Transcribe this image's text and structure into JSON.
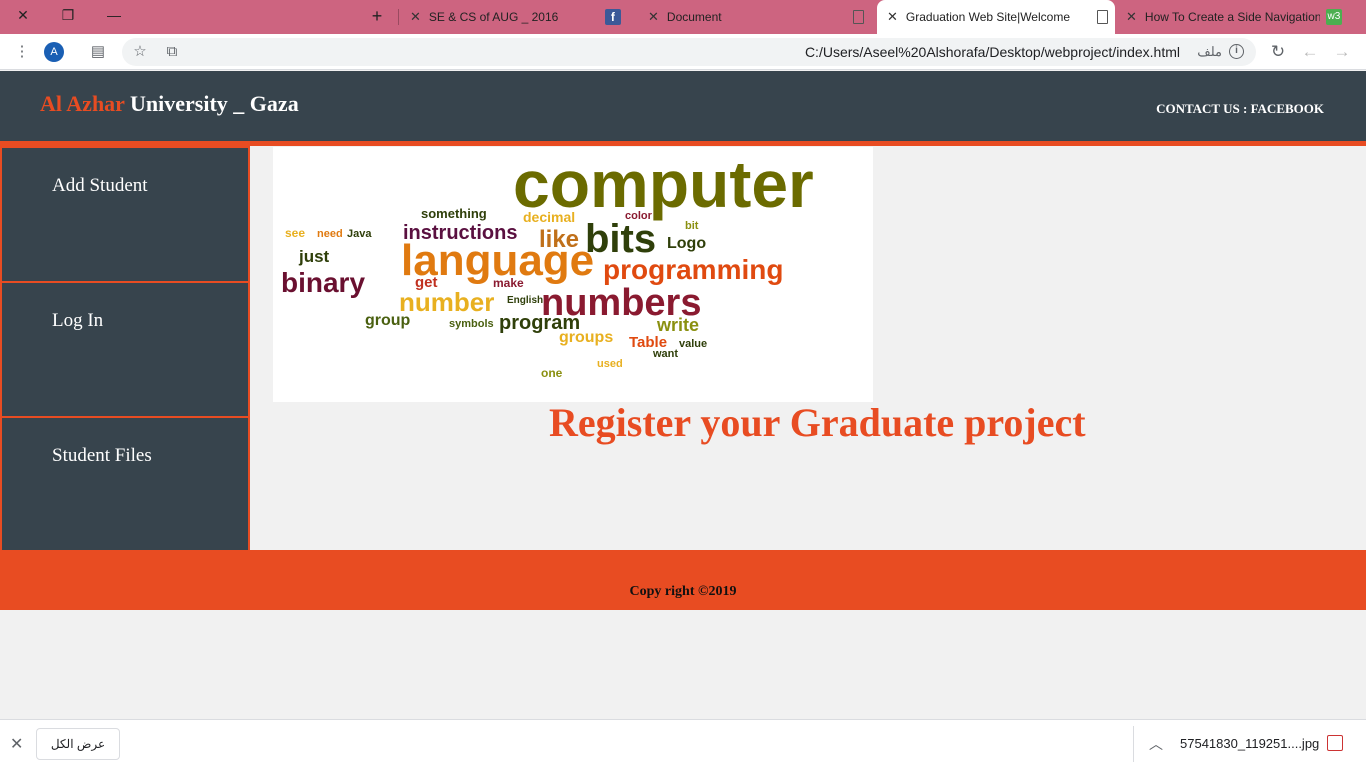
{
  "browser": {
    "tabs": [
      {
        "title": "SE & CS of AUG _ 2016",
        "active": false
      },
      {
        "title": "Document",
        "active": false
      },
      {
        "title": "Graduation Web Site|Welcome",
        "active": true
      },
      {
        "title": "How To Create a Side Navigation",
        "active": false
      }
    ],
    "url": "C:/Users/Aseel%20Alshorafa/Desktop/webproject/index.html",
    "url_prefix": "ملف",
    "avatar_letter": "A"
  },
  "header": {
    "brand_accent": "Al Azhar",
    "brand_rest": " University _ Gaza",
    "contact": "CONTACT US : FACEBOOK"
  },
  "sidebar": {
    "items": [
      {
        "label": "Add Student"
      },
      {
        "label": "Log In"
      },
      {
        "label": "Student Files"
      }
    ]
  },
  "main": {
    "headline": "Register your Graduate project",
    "wordcloud_words": [
      "computer",
      "bits",
      "language",
      "numbers",
      "programming",
      "binary",
      "instructions",
      "number",
      "like",
      "program",
      "decimal",
      "write",
      "groups",
      "Logo",
      "Table",
      "something",
      "just",
      "group",
      "get",
      "see",
      "need",
      "Java",
      "make",
      "English",
      "symbols",
      "used",
      "one",
      "want",
      "value",
      "bit",
      "color"
    ]
  },
  "footer": {
    "copyright": "Copy right ©2019"
  },
  "downloads": {
    "show_all": "عرض الكل",
    "file": "57541830_119251....jpg"
  },
  "colors": {
    "accent": "#e84c22",
    "dark": "#37444d",
    "tabstrip": "#cd6480"
  }
}
